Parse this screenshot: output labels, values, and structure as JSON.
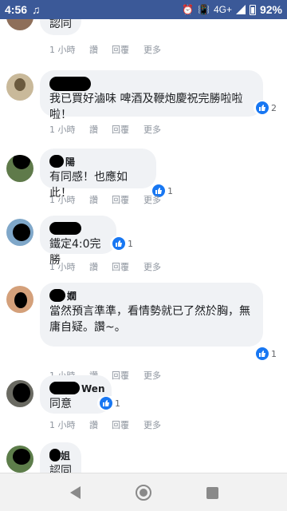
{
  "status_bar": {
    "time": "4:56",
    "network": "4G+",
    "battery": "92%"
  },
  "comments": [
    {
      "name": "",
      "text": "認同",
      "time": "1 小時",
      "like": "讚",
      "reply": "回覆",
      "more": "更多",
      "reactions": ""
    },
    {
      "name": "",
      "text": "我已買好滷味 啤酒及鞭炮慶祝完勝啦啦啦！",
      "time": "1 小時",
      "like": "讚",
      "reply": "回覆",
      "more": "更多",
      "reactions": "2"
    },
    {
      "name": "陽",
      "text": "有同感！也應如此！",
      "time": "1 小時",
      "like": "讚",
      "reply": "回覆",
      "more": "更多",
      "reactions": "1"
    },
    {
      "name": "",
      "text": "鐵定4:0完勝",
      "time": "1 小時",
      "like": "讚",
      "reply": "回覆",
      "more": "更多",
      "reactions": "1"
    },
    {
      "name": "嫺",
      "text": "當然預言準準，看情勢就已了然於胸，無庸自疑。讚~。",
      "time": "1 小時",
      "like": "讚",
      "reply": "回覆",
      "more": "更多",
      "reactions": "1"
    },
    {
      "name": "Wen",
      "text": "同意",
      "time": "1 小時",
      "like": "讚",
      "reply": "回覆",
      "more": "更多",
      "reactions": "1"
    },
    {
      "name": "姐",
      "text": "認同",
      "time": "",
      "like": "",
      "reply": "",
      "more": "",
      "reactions": ""
    }
  ],
  "icons": {
    "like": "thumbs-up-icon",
    "back": "back-icon",
    "home": "home-icon",
    "recents": "recents-icon"
  },
  "colors": {
    "status_bar": "#3b5998",
    "like_blue": "#1877f2",
    "bubble": "#f0f2f5"
  }
}
